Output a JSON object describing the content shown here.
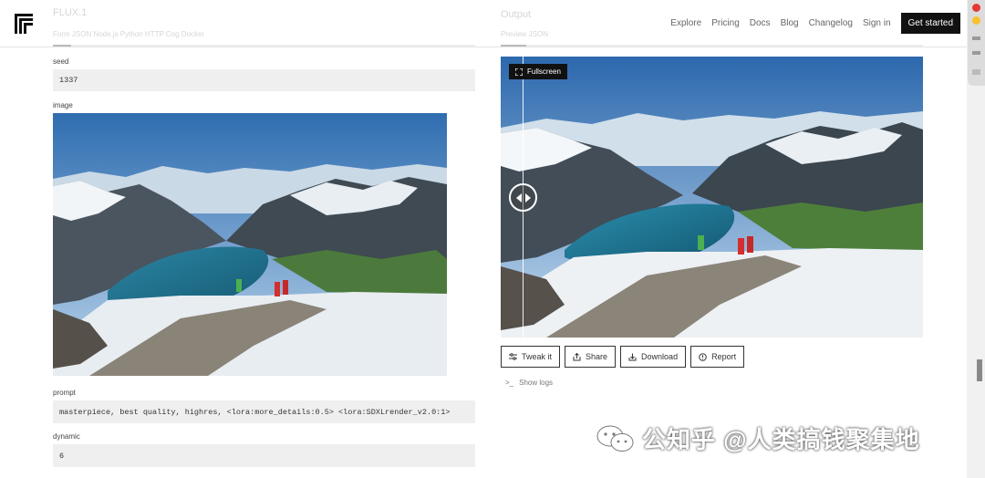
{
  "header": {
    "left_ghost_title": "FLUX.1",
    "left_ghost_tabs": "Form  JSON  Node.js  Python  HTTP  Cog  Docker",
    "right_ghost_title": "Output",
    "right_ghost_tabs": "Preview  JSON",
    "nav": [
      "Explore",
      "Pricing",
      "Docs",
      "Blog",
      "Changelog",
      "Sign in"
    ],
    "cta": "Get started"
  },
  "form": {
    "seed_label": "seed",
    "seed_value": "1337",
    "image_label": "image",
    "prompt_label": "prompt",
    "prompt_value": "masterpiece, best quality, highres, <lora:more_details:0.5> <lora:SDXLrender_v2.0:1>",
    "dynamic_label": "dynamic",
    "dynamic_value": "6"
  },
  "output": {
    "fullscreen_label": "Fullscreen",
    "actions": [
      "Tweak it",
      "Share",
      "Download",
      "Report"
    ],
    "logs_label": "Show logs"
  },
  "watermark": {
    "text": "公知乎 @人类搞钱聚集地"
  },
  "colors": {
    "accent": "#111111",
    "field_bg": "#efefef",
    "sky_top": "#2f6db0",
    "lake": "#1f6f8b"
  },
  "icons": [
    "logo-icon",
    "fullscreen-icon",
    "compare-arrows-icon",
    "tweak-icon",
    "share-icon",
    "download-icon",
    "report-icon",
    "terminal-icon",
    "wechat-icon"
  ]
}
